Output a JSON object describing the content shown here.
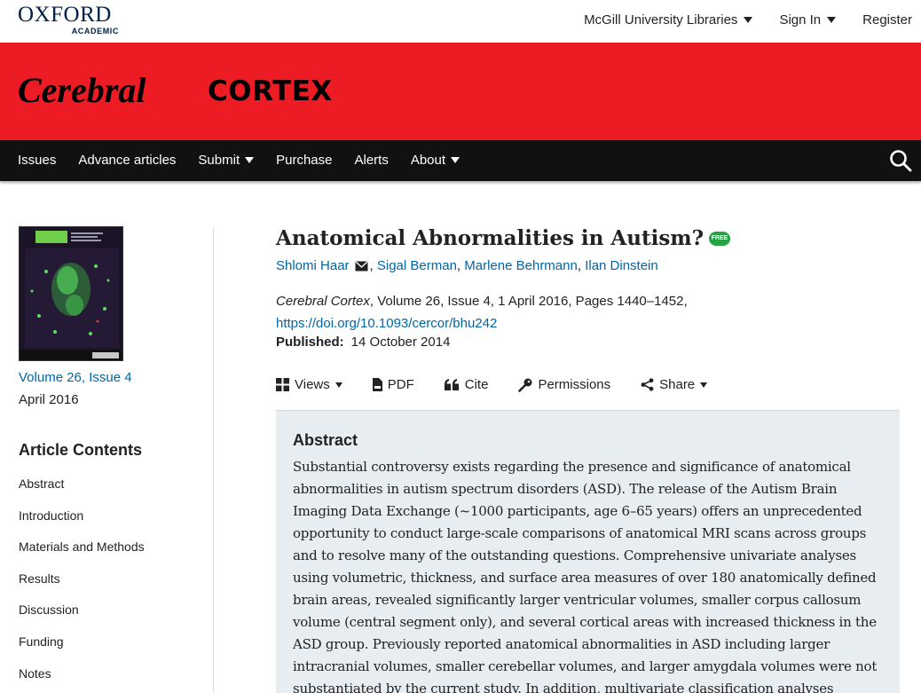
{
  "header": {
    "logo_main": "OXFORD",
    "logo_sub": "ACADEMIC",
    "links": [
      {
        "label": "McGill University Libraries",
        "has_caret": true
      },
      {
        "label": "Sign In",
        "has_caret": true
      },
      {
        "label": "Register",
        "has_caret": false
      }
    ]
  },
  "banner": {
    "journal_word1": "Cerebral",
    "journal_word2": "CORTEX",
    "background": "#ed1c24"
  },
  "nav": {
    "items": [
      {
        "label": "Issues"
      },
      {
        "label": "Advance articles"
      },
      {
        "label": "Submit"
      },
      {
        "label": "Purchase"
      },
      {
        "label": "Alerts"
      },
      {
        "label": "About"
      }
    ],
    "search_icon": "search-icon"
  },
  "sidebar": {
    "volume_link": "Volume 26, Issue 4",
    "issue_date": "April 2016",
    "contents_title": "Article Contents",
    "toc": [
      "Abstract",
      "Introduction",
      "Materials and Methods",
      "Results",
      "Discussion",
      "Funding",
      "Notes"
    ]
  },
  "article": {
    "title": "Anatomical Abnormalities in Autism?",
    "free_badge": "FREE",
    "authors": [
      "Shlomi Haar",
      "Sigal Berman",
      "Marlene Behrmann",
      "Ilan Dinstein"
    ],
    "author_sep": ",",
    "journal_name": "Cerebral Cortex",
    "citation_rest": ", Volume 26, Issue 4, 1 April 2016, Pages 1440–1452, ",
    "doi": "https://doi.org/10.1093/cercor/bhu242",
    "published_label": "Published:",
    "published_date": "14 October 2014"
  },
  "toolbar": {
    "views": "Views",
    "pdf": "PDF",
    "cite": "Cite",
    "permissions": "Permissions",
    "share": "Share"
  },
  "abstract": {
    "title": "Abstract",
    "text": "Substantial controversy exists regarding the presence and significance of anatomical abnormalities in autism spectrum disorders (ASD). The release of the Autism Brain Imaging Data Exchange (~1000 participants, age 6–65 years) offers an unprecedented opportunity to conduct large-scale comparisons of anatomical MRI scans across groups and to resolve many of the outstanding questions. Comprehensive univariate analyses using volumetric, thickness, and surface area measures of over 180 anatomically defined brain areas, revealed significantly larger ventricular volumes, smaller corpus callosum volume (central segment only), and several cortical areas with increased thickness in the ASD group. Previously reported anatomical abnormalities in ASD including larger intracranial volumes, smaller cerebellar volumes, and larger amygdala volumes were not substantiated by the current study. In addition, multivariate classification analyses"
  },
  "colors": {
    "link": "#0066a6",
    "nav_bg": "#111111",
    "abstract_bg": "#e8edf2",
    "free_badge": "#25a244"
  }
}
